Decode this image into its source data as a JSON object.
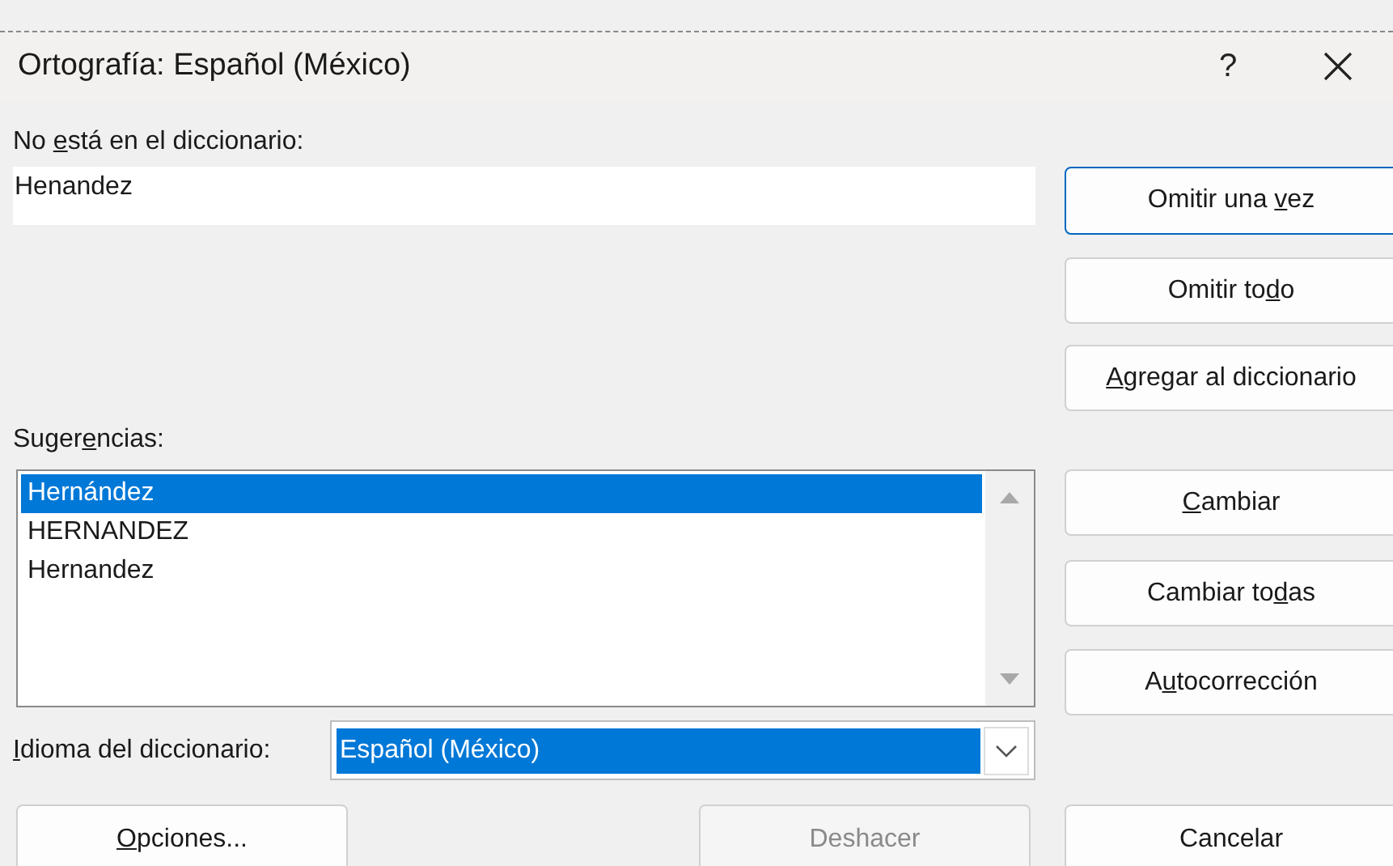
{
  "window": {
    "title": "Ortografía: Español (México)",
    "help": "?"
  },
  "not_in_dictionary": {
    "label": {
      "pre": "No ",
      "key": "e",
      "post": "stá en el diccionario:"
    },
    "value": "Henandez"
  },
  "suggestions": {
    "label": {
      "pre": "Suger",
      "key": "e",
      "post": "ncias:"
    },
    "items": [
      {
        "text": "Hernández",
        "selected": true
      },
      {
        "text": "HERNANDEZ",
        "selected": false
      },
      {
        "text": "Hernandez",
        "selected": false
      }
    ]
  },
  "dictionary_language": {
    "label": {
      "key": "I",
      "post": "dioma del diccionario:"
    },
    "value": "Español (México)",
    "focused": true
  },
  "side_buttons": [
    {
      "pre": "Omitir una ",
      "key": "v",
      "post": "ez",
      "default": true
    },
    {
      "pre": "Omitir to",
      "key": "d",
      "post": "o",
      "default": false
    },
    {
      "key": "A",
      "post": "gregar al diccionario",
      "default": false
    },
    {
      "key": "C",
      "post": "ambiar",
      "default": false
    },
    {
      "pre": "Cambiar to",
      "key": "d",
      "post": "as",
      "default": false
    },
    {
      "pre": "A",
      "key": "u",
      "post": "tocorrección",
      "default": false
    }
  ],
  "bottom_buttons": [
    {
      "key": "O",
      "post": "pciones...",
      "disabled": false
    },
    {
      "pre": "Deshacer",
      "disabled": true
    },
    {
      "pre": "Cancelar",
      "disabled": false
    }
  ]
}
